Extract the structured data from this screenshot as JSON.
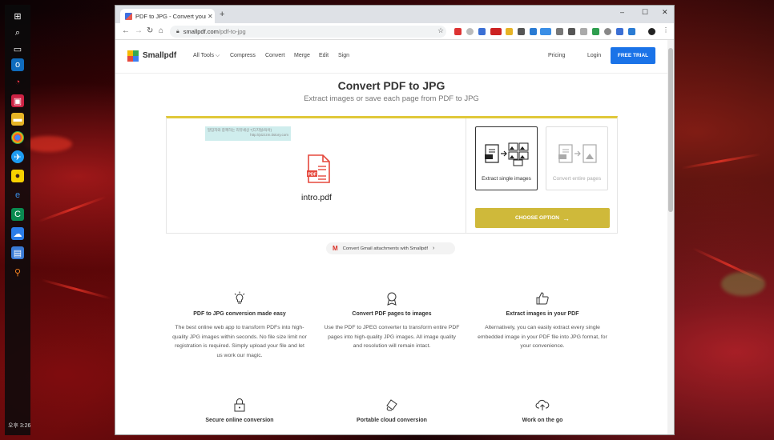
{
  "desktop": {
    "clock": "오후 3:26"
  },
  "browser": {
    "tab_title": "PDF to JPG - Convert your PDF t",
    "url_host": "smallpdf.com",
    "url_path": "/pdf-to-jpg",
    "window_buttons": [
      "–",
      "☐",
      "✕"
    ]
  },
  "site": {
    "logo": "Smallpdf",
    "nav": [
      "All Tools",
      "Compress",
      "Convert",
      "Merge",
      "Edit",
      "Sign"
    ],
    "pricing": "Pricing",
    "login": "Login",
    "free_trial": "FREE TRIAL",
    "title": "Convert PDF to JPG",
    "subtitle": "Extract images or save each page from PDF to JPG",
    "watermark_line1": "말잠자와 함께하는 리뷰세상 *(디지털/육아)",
    "watermark_line2": "http://pizzzm.tistory.com",
    "file_name": "intro.pdf",
    "option_single": "Extract single images",
    "option_pages": "Convert entire pages",
    "choose_option": "CHOOSE OPTION",
    "gmail_pill": "Convert Gmail attachments with Smallpdf",
    "features": [
      {
        "title": "PDF to JPG conversion made easy",
        "desc": "The best online web app to transform PDFs into high-quality JPG images within seconds. No file size limit nor registration is required. Simply upload your file and let us work our magic."
      },
      {
        "title": "Convert PDF pages to images",
        "desc": "Use the PDF to JPEG converter to transform entire PDF pages into high-quality JPG images. All image quality and resolution will remain intact."
      },
      {
        "title": "Extract images in your PDF",
        "desc": "Alternatively, you can easily extract every single embedded image in your PDF file into JPG format, for your convenience."
      },
      {
        "title": "Secure online conversion",
        "desc": ""
      },
      {
        "title": "Portable cloud conversion",
        "desc": ""
      },
      {
        "title": "Work on the go",
        "desc": ""
      }
    ]
  },
  "colors": {
    "accent_yellow": "#cfb93a",
    "trial_blue": "#1a73e8",
    "pdf_red": "#e5483d"
  }
}
